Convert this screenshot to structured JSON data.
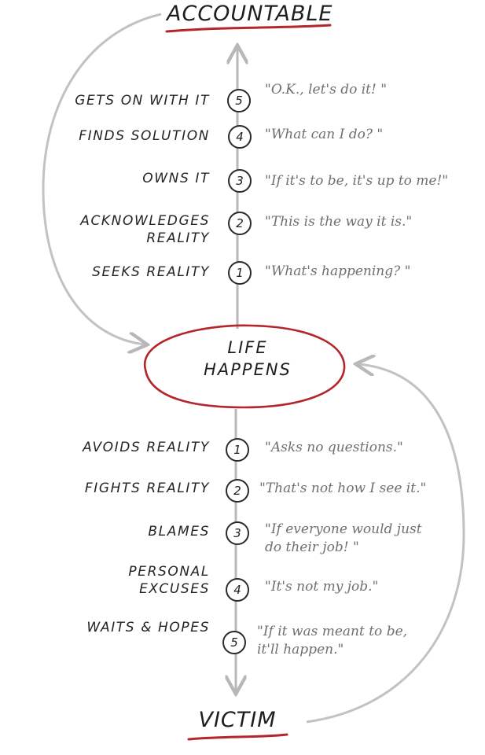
{
  "top_label": "ACCOUNTABLE",
  "center_label": {
    "line1": "LIFE",
    "line2": "HAPPENS"
  },
  "bottom_label": "VICTIM",
  "accountable_steps": [
    {
      "number": "5",
      "behavior": "GETS ON WITH IT",
      "quote": "\"O.K., let's do it! \""
    },
    {
      "number": "4",
      "behavior": "FINDS SOLUTION",
      "quote": "\"What can I do? \""
    },
    {
      "number": "3",
      "behavior": "OWNS IT",
      "quote": "\"If it's to be, it's up to me!\""
    },
    {
      "number": "2",
      "behavior_line1": "ACKNOWLEDGES",
      "behavior_line2": "REALITY",
      "quote": "\"This is the way it is.\""
    },
    {
      "number": "1",
      "behavior": "SEEKS REALITY",
      "quote": "\"What's happening? \""
    }
  ],
  "victim_steps": [
    {
      "number": "1",
      "behavior": "AVOIDS REALITY",
      "quote": "\"Asks no questions.\""
    },
    {
      "number": "2",
      "behavior": "FIGHTS REALITY",
      "quote": "\"That's not how I see it.\""
    },
    {
      "number": "3",
      "behavior": "BLAMES",
      "quote": "\"If everyone would just do their job! \""
    },
    {
      "number": "4",
      "behavior_line1": "PERSONAL",
      "behavior_line2": "EXCUSES",
      "quote": "\"It's not my job.\""
    },
    {
      "number": "5",
      "behavior": "WAITS & HOPES",
      "quote": "\"If it was meant to be, it'll happen.\""
    }
  ],
  "colors": {
    "accent_red": "#b3262b",
    "ink": "#1e1e1e",
    "quote_gray": "#6f6f6f",
    "line_gray": "#b8b8b8"
  }
}
